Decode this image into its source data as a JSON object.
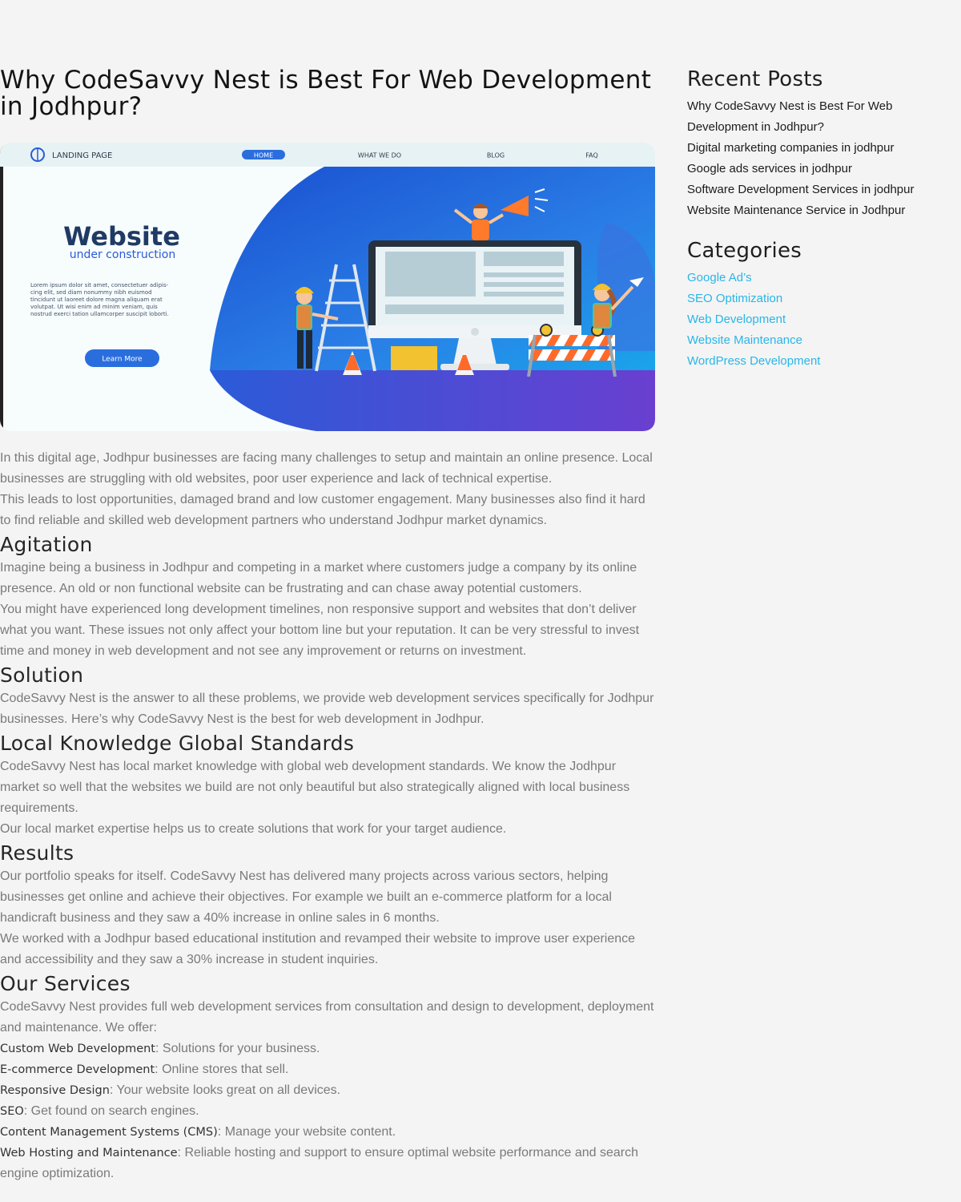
{
  "post": {
    "title": "Why CodeSavvy Nest is Best For Web Development in Jodhpur?",
    "hero": {
      "nav_brand": "LANDING PAGE",
      "nav_items": [
        "HOME",
        "WHAT WE DO",
        "BLOG",
        "FAQ"
      ],
      "heading": "Website",
      "subheading": "under construction",
      "lorem_lines": [
        "Lorem ipsum dolor sit amet, consectetuer adipis-",
        "cing elit, sed diam nonummy nibh euismod",
        "tincidunt ut laoreet dolore magna aliquam erat",
        "volutpat. Ut wisi enim ad minim veniam, quis",
        "nostrud exerci tation ullamcorper suscipit loborti."
      ],
      "cta": "Learn More"
    },
    "intro_1": "In this digital age, Jodhpur businesses are facing many challenges to setup and maintain an online presence. Local businesses are struggling with old websites, poor user experience and lack of technical expertise.",
    "intro_2": "This leads to lost opportunities, damaged brand and low customer engagement. Many businesses also find it hard to find reliable and skilled web development partners who understand Jodhpur market dynamics.",
    "agitation_heading": "Agitation",
    "agitation_1": "Imagine being a business in Jodhpur and competing in a market where customers judge a company by its online presence. An old or non functional website can be frustrating and can chase away potential customers.",
    "agitation_2": "You might have experienced long development timelines, non responsive support and websites that don’t deliver what you want. These issues not only affect your bottom line but your reputation. It can be very stressful to invest time and money in web development and not see any improvement or returns on investment.",
    "solution_heading": "Solution",
    "solution_1": "CodeSavvy Nest is the answer to all these problems, we provide web development services specifically for Jodhpur businesses. Here’s why CodeSavvy Nest is the best for web development in Jodhpur.",
    "local_heading": "Local Knowledge Global Standards",
    "local_1": "CodeSavvy Nest has local market knowledge with global web development standards. We know the Jodhpur market so well that the websites we build are not only beautiful but also strategically aligned with local business requirements.",
    "local_2": "Our local market expertise helps us to create solutions that work for your target audience.",
    "results_heading": "Results",
    "results_1": "Our portfolio speaks for itself. CodeSavvy Nest has delivered many projects across various sectors, helping businesses get online and achieve their objectives. For example we built an e-commerce platform for a local handicraft business and they saw a 40% increase in online sales in 6 months.",
    "results_2": "We worked with a Jodhpur based educational institution and revamped their website to improve user experience and accessibility and they saw a 30% increase in student inquiries.",
    "services_heading": "Our Services",
    "services_intro": "CodeSavvy Nest provides full web development services from consultation and design to development, deployment and maintenance. We offer:",
    "services": [
      {
        "name": "Custom Web Development",
        "desc": ": Solutions for your business."
      },
      {
        "name": "E-commerce Development",
        "desc": ": Online stores that sell."
      },
      {
        "name": "Responsive Design",
        "desc": ": Your website looks great on all devices."
      },
      {
        "name": "SEO",
        "desc": ": Get found on search engines."
      },
      {
        "name": "Content Management Systems (CMS)",
        "desc": ": Manage your website content."
      },
      {
        "name": "Web Hosting and Maintenance",
        "desc": ": Reliable hosting and support to ensure optimal website performance and search engine optimization."
      }
    ]
  },
  "sidebar": {
    "recent_title": "Recent Posts",
    "recent": [
      "Why CodeSavvy Nest is Best For Web Development in Jodhpur?",
      "Digital marketing companies in jodhpur",
      "Google ads services in jodhpur",
      "Software Development Services in jodhpur",
      "Website Maintenance Service in Jodhpur"
    ],
    "categories_title": "Categories",
    "categories": [
      "Google Ad’s",
      "SEO Optimization",
      "Web Development",
      "Website Maintenance",
      "WordPress Development"
    ]
  },
  "colors": {
    "background": "#f4f4f4",
    "link": "#29b6e8",
    "hero_blue": "#1d5fd6",
    "hero_purple": "#6a3fd0"
  }
}
